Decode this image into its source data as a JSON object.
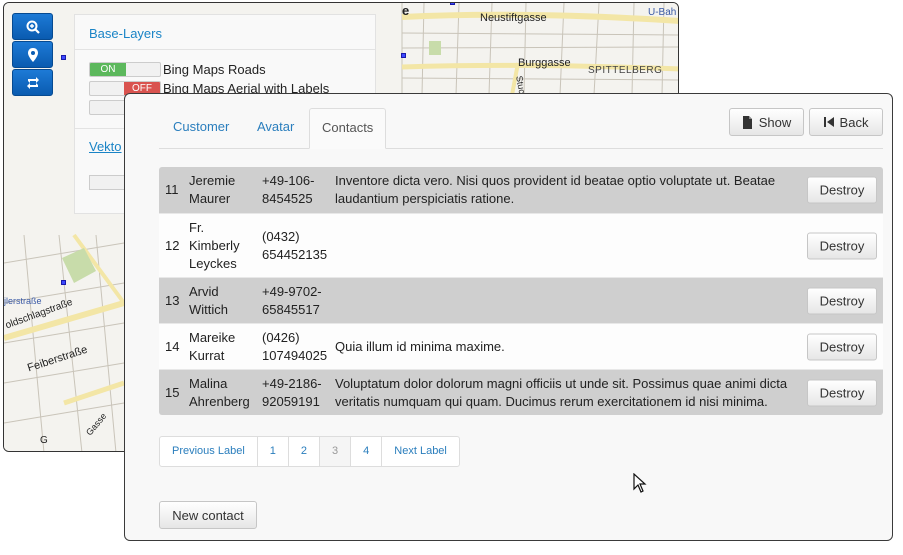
{
  "map": {
    "street_labels": [
      "Neustiftgasse",
      "Burggasse",
      "Spittelberg",
      "U-Bah",
      "e",
      "Stuc",
      "Feiberstraße",
      "oldschlagstraße",
      "jlerstraße",
      "Gasse",
      "G"
    ]
  },
  "layers": {
    "title": "Base-Layers",
    "items": [
      {
        "label": "Bing Maps Roads",
        "state": "ON"
      },
      {
        "label": "Bing Maps Aerial with Labels",
        "state": "OFF"
      }
    ],
    "vektor": "Vekto"
  },
  "dialog": {
    "tabs": [
      "Customer",
      "Avatar",
      "Contacts"
    ],
    "active_tab": "Contacts",
    "show_label": "Show",
    "back_label": "Back",
    "destroy_label": "Destroy",
    "rows": [
      {
        "id": "11",
        "name_1": "Jeremie",
        "name_2": "Maurer",
        "name_3": "",
        "phone_1": "+49-106-",
        "phone_2": "8454525",
        "note_1": "Inventore dicta vero. Nisi quos provident id beatae optio voluptate ut. Beatae",
        "note_2": "laudantium perspiciatis ratione."
      },
      {
        "id": "12",
        "name_1": "Fr.",
        "name_2": "Kimberly",
        "name_3": "Leyckes",
        "phone_1": "(0432)",
        "phone_2": "654452135",
        "note_1": "",
        "note_2": ""
      },
      {
        "id": "13",
        "name_1": "Arvid",
        "name_2": "Wittich",
        "name_3": "",
        "phone_1": "+49-9702-",
        "phone_2": "65845517",
        "note_1": "",
        "note_2": ""
      },
      {
        "id": "14",
        "name_1": "Mareike",
        "name_2": "Kurrat",
        "name_3": "",
        "phone_1": "(0426)",
        "phone_2": "107494025",
        "note_1": "Quia illum id minima maxime.",
        "note_2": ""
      },
      {
        "id": "15",
        "name_1": "Malina",
        "name_2": "Ahrenberg",
        "name_3": "",
        "phone_1": "+49-2186-",
        "phone_2": "92059191",
        "note_1": "Voluptatum dolor dolorum magni officiis ut unde sit. Possimus quae animi dicta",
        "note_2": "veritatis numquam qui quam. Ducimus rerum exercitationem id nisi minima."
      }
    ],
    "pagination": [
      "Previous Label",
      "1",
      "2",
      "3",
      "4",
      "Next Label"
    ],
    "current_page": "3",
    "new_contact_label": "New contact"
  }
}
